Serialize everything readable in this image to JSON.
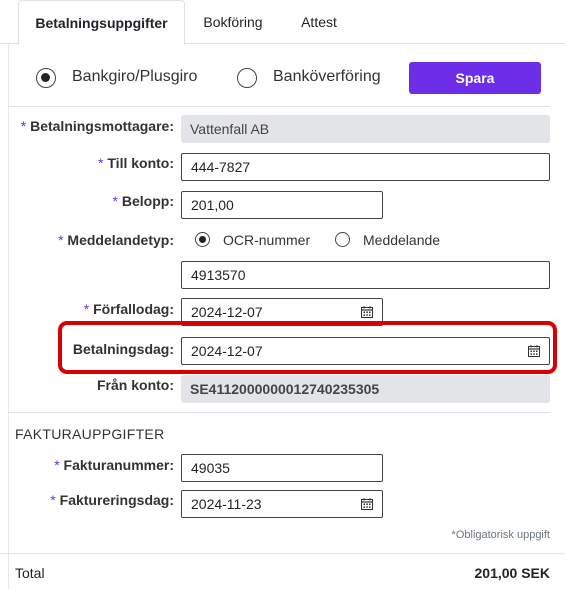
{
  "tabs": [
    {
      "label": "Betalningsuppgifter"
    },
    {
      "label": "Bokföring"
    },
    {
      "label": "Attest"
    }
  ],
  "payment_method": {
    "options": [
      {
        "label": "Bankgiro/Plusgiro",
        "selected": true
      },
      {
        "label": "Banköverföring",
        "selected": false
      }
    ],
    "save_label": "Spara"
  },
  "required_marker": "*",
  "form": {
    "recipient": {
      "label": "Betalningsmottagare:",
      "value": "Vattenfall AB"
    },
    "to_account": {
      "label": "Till konto:",
      "value": "444-7827"
    },
    "amount": {
      "label": "Belopp:",
      "value": "201,00"
    },
    "message_type": {
      "label": "Meddelandetyp:",
      "options": [
        {
          "label": "OCR-nummer",
          "selected": true
        },
        {
          "label": "Meddelande",
          "selected": false
        }
      ]
    },
    "message_value": "4913570",
    "due_date": {
      "label": "Förfallodag:",
      "value": "2024-12-07"
    },
    "payment_date": {
      "label": "Betalningsdag:",
      "value": "2024-12-07"
    },
    "from_account": {
      "label": "Från konto:",
      "value": "SE4112000000012740235305"
    }
  },
  "invoice": {
    "section_title": "FAKTURAUPPGIFTER",
    "invoice_number": {
      "label": "Fakturanummer:",
      "value": "49035"
    },
    "invoice_date": {
      "label": "Faktureringsdag:",
      "value": "2024-11-23"
    }
  },
  "required_note": "*Obligatorisk uppgift",
  "total": {
    "label": "Total",
    "value": "201,00 SEK"
  },
  "colors": {
    "accent": "#6c2ee8",
    "highlight": "#d80000"
  },
  "icons": {
    "date_picker": "calendar-icon"
  }
}
